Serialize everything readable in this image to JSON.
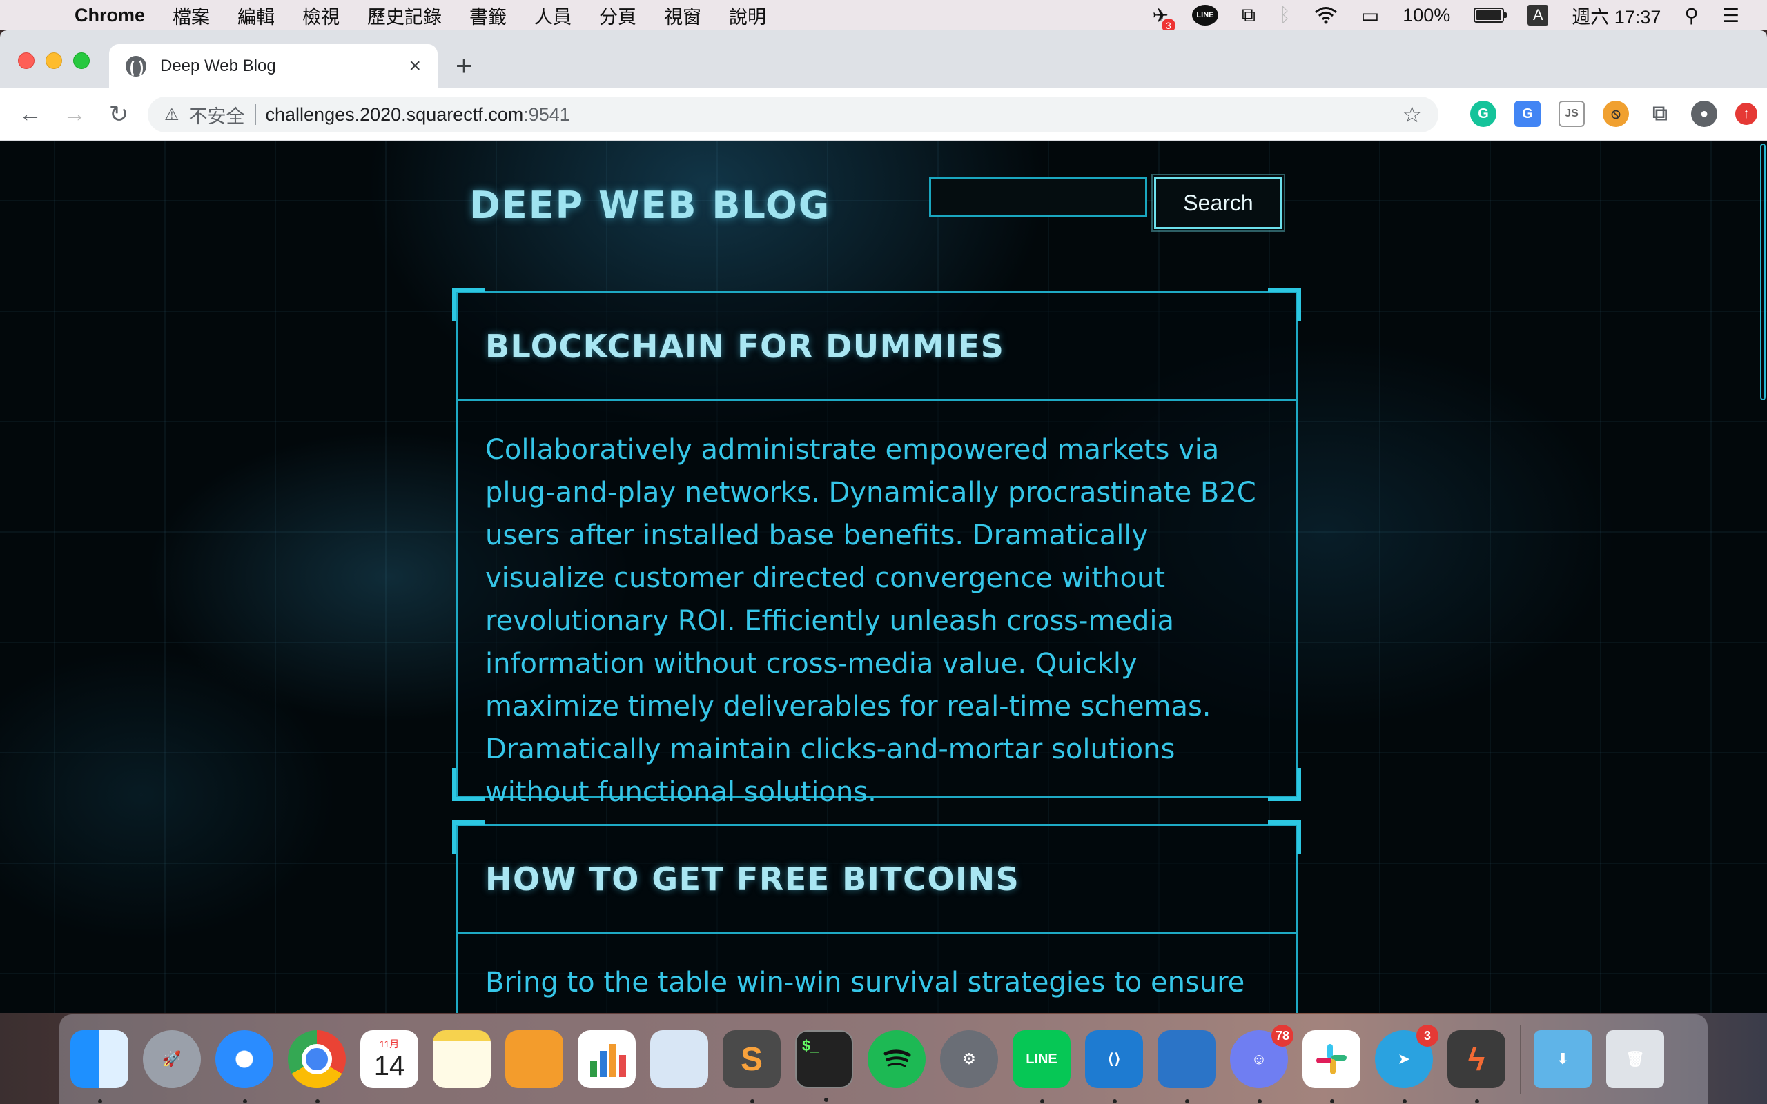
{
  "menubar": {
    "apple": "",
    "app_name": "Chrome",
    "items": [
      "檔案",
      "編輯",
      "檢視",
      "歷史記錄",
      "書籤",
      "人員",
      "分頁",
      "視窗",
      "說明"
    ],
    "status": {
      "notification_badge": "3",
      "line_label": "LINE",
      "battery": "100%",
      "battery_level": 1.0,
      "input_source": "A",
      "clock": "週六 17:37"
    }
  },
  "browser": {
    "tab_title": "Deep Web Blog",
    "tab_close": "×",
    "new_tab": "+",
    "back": "←",
    "forward": "→",
    "reload": "↻",
    "security_icon": "⚠",
    "security_label": "不安全",
    "url_host": "challenges.2020.squarectf.com",
    "url_port": ":9541",
    "bookmark_star": "☆",
    "extensions": [
      {
        "name": "grammarly",
        "glyph": "G"
      },
      {
        "name": "translate",
        "glyph": "G"
      },
      {
        "name": "js",
        "glyph": "JS"
      },
      {
        "name": "block",
        "glyph": "⦸"
      },
      {
        "name": "extensions-puzzle",
        "glyph": "⧉"
      },
      {
        "name": "account",
        "glyph": "●"
      },
      {
        "name": "update",
        "glyph": "↑"
      }
    ]
  },
  "page": {
    "site_title": "DEEP WEB BLOG",
    "search_placeholder": "",
    "search_button": "Search",
    "posts": [
      {
        "title": "BLOCKCHAIN FOR DUMMIES",
        "body": "Collaboratively administrate empowered markets via plug-and-play networks. Dynamically procrastinate B2C users after installed base benefits. Dramatically visualize customer directed convergence without revolutionary ROI. Efficiently unleash cross-media information without cross-media value. Quickly maximize timely deliverables for real-time schemas. Dramatically maintain clicks-and-mortar solutions without functional solutions."
      },
      {
        "title": "HOW TO GET FREE BITCOINS",
        "body": "Bring to the table win-win survival strategies to ensure proactive domination. At the end of the day, going"
      }
    ]
  },
  "dock": {
    "calendar_month": "11月",
    "calendar_day": "14",
    "terminal_prompt": "$_",
    "line_label": "LINE",
    "discord_badge": "78",
    "telegram_badge": "3"
  }
}
